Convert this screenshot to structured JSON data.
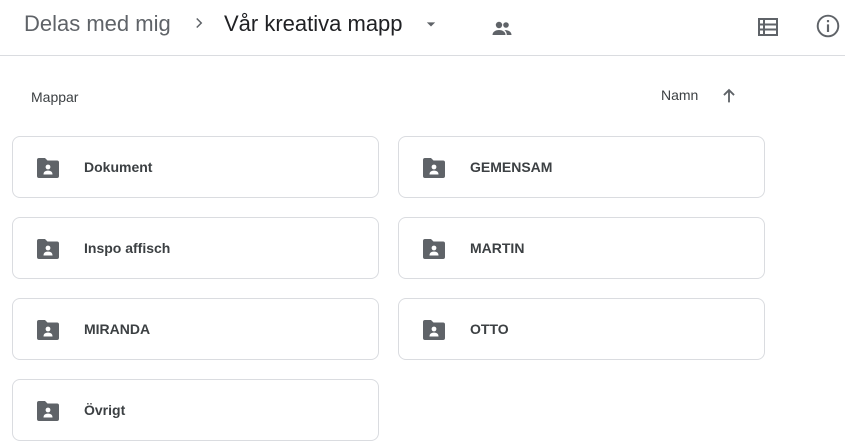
{
  "breadcrumb": {
    "root": "Delas med mig",
    "current": "Vår kreativa mapp"
  },
  "icons": {
    "separator": "chevron-right-icon",
    "dropdown": "caret-down-icon",
    "shared": "people-icon",
    "view": "list-view-icon",
    "info": "info-icon",
    "folder": "shared-folder-icon",
    "sort": "arrow-up-icon"
  },
  "section": {
    "label": "Mappar"
  },
  "sort": {
    "label": "Namn",
    "direction": "ascending"
  },
  "folders": [
    {
      "name": "Dokument"
    },
    {
      "name": "GEMENSAM"
    },
    {
      "name": "Inspo affisch"
    },
    {
      "name": "MARTIN"
    },
    {
      "name": "MIRANDA"
    },
    {
      "name": "OTTO"
    },
    {
      "name": "Övrigt"
    }
  ],
  "colors": {
    "icon": "#5f6368",
    "text": "#3c4043",
    "border": "#dadce0"
  }
}
